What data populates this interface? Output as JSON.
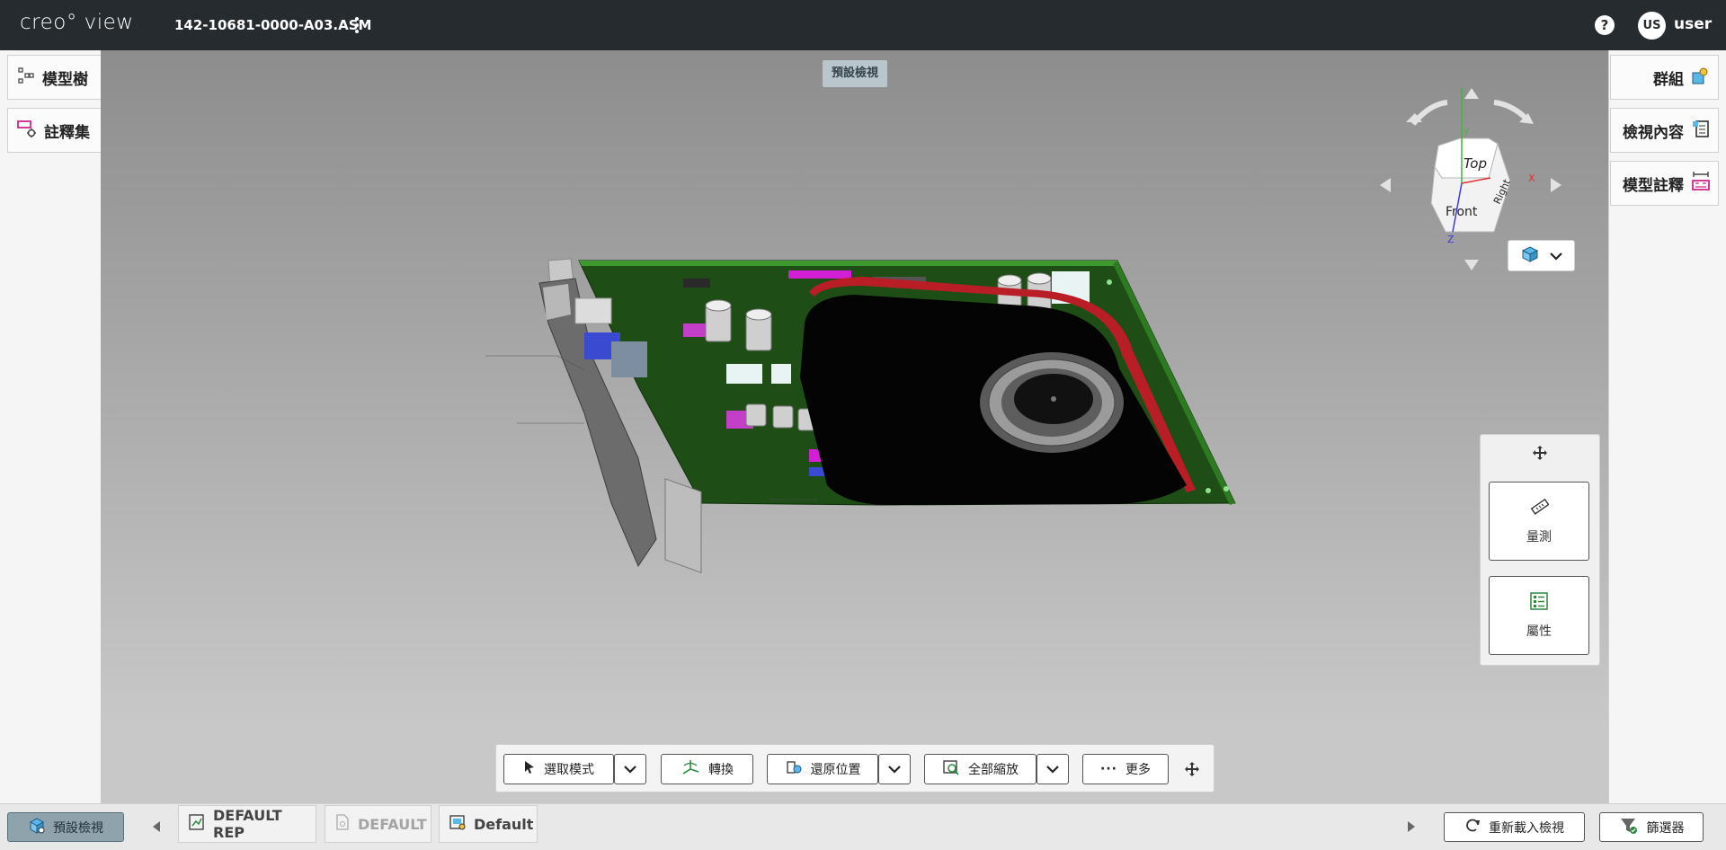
{
  "header": {
    "logo": "creo° view",
    "filename": "142-10681-0000-A03.ASM",
    "help_symbol": "?",
    "user_initials": "US",
    "username": "user"
  },
  "left_panel": {
    "tabs": [
      {
        "label": "模型樹",
        "icon": "model-tree-icon"
      },
      {
        "label": "註釋集",
        "icon": "annotation-set-icon"
      }
    ]
  },
  "right_panel": {
    "tabs": [
      {
        "label": "群組",
        "icon": "groups-icon"
      },
      {
        "label": "檢視內容",
        "icon": "view-content-icon"
      },
      {
        "label": "模型註釋",
        "icon": "model-annotation-icon"
      }
    ]
  },
  "viewport": {
    "view_label": "預設檢視",
    "cube": {
      "top": "Top",
      "front": "Front",
      "right": "Right",
      "axis_x": "X",
      "axis_y": "Y",
      "axis_z": "Z"
    }
  },
  "tool_palette": {
    "measure_label": "量測",
    "properties_label": "屬性"
  },
  "toolbar": {
    "select_mode": "選取模式",
    "transform": "轉換",
    "restore_position": "還原位置",
    "zoom_all": "全部縮放",
    "more": "更多"
  },
  "bottom_bar": {
    "active_view": "預設檢視",
    "tabs": [
      {
        "label": "DEFAULT REP",
        "enabled": true
      },
      {
        "label": "DEFAULT",
        "enabled": false
      },
      {
        "label": "Default",
        "enabled": true
      }
    ],
    "reload_view": "重新載入檢視",
    "filter": "篩選器"
  },
  "colors": {
    "header_bg": "#262b30",
    "accent_pink": "#d0288c",
    "active_tab": "#8fa3ad",
    "pcb_green": "#1e4d16"
  }
}
